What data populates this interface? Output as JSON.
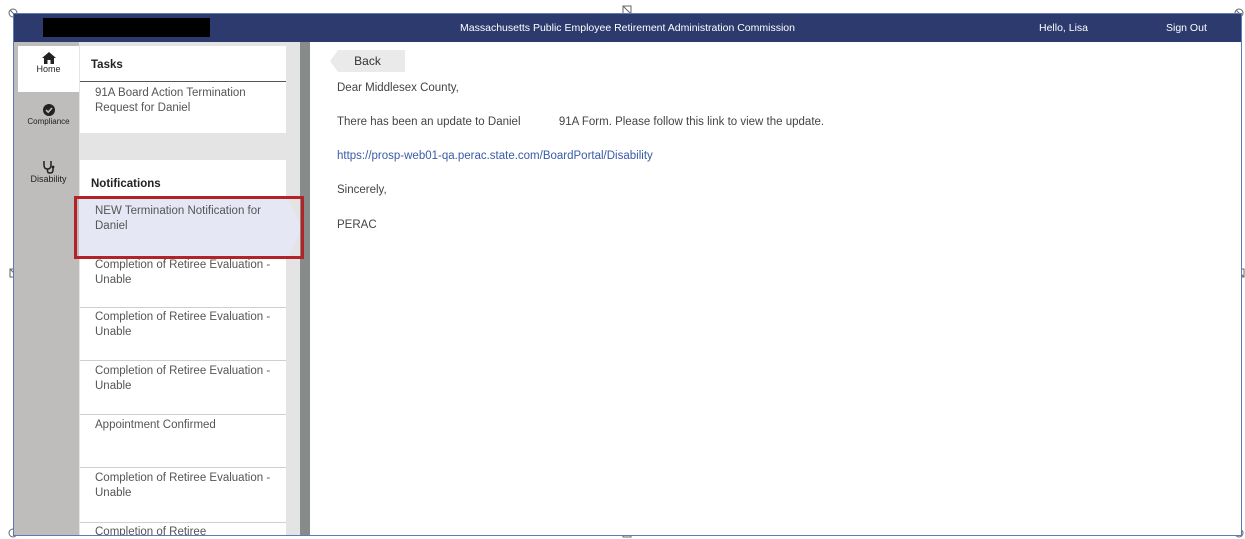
{
  "header": {
    "app_title": "Massachusetts Public Employee Retirement Administration Commission",
    "greeting": "Hello, Lisa",
    "sign_out": "Sign Out"
  },
  "nav": {
    "items": [
      {
        "label": "Home",
        "icon": "home-icon",
        "active": true
      },
      {
        "label": "Compliance",
        "icon": "check-circle-icon",
        "active": false
      },
      {
        "label": "Disability",
        "icon": "stethoscope-icon",
        "active": false
      }
    ]
  },
  "tasks": {
    "heading": "Tasks",
    "items": [
      "91A Board Action Termination Request for Daniel"
    ]
  },
  "notifications": {
    "heading": "Notifications",
    "items": [
      "NEW Termination Notification for Daniel",
      "Completion of Retiree Evaluation - Unable",
      "Completion of Retiree Evaluation - Unable",
      "Completion of Retiree Evaluation - Unable",
      "Appointment Confirmed",
      "Completion of Retiree Evaluation - Unable",
      "Completion of Retiree"
    ]
  },
  "message": {
    "back_label": "Back",
    "salutation": "Dear Middlesex County,",
    "body": "There has been an update to Daniel            91A Form. Please follow this link to view the update.",
    "link": "https://prosp-web01-qa.perac.state.com/BoardPortal/Disability",
    "closing": "Sincerely,",
    "signature": "PERAC"
  },
  "colors": {
    "header_bg": "#2c3a6e",
    "nav_bg": "#bfbcbc",
    "highlight": "#b22227",
    "link": "#3a5aa8"
  }
}
